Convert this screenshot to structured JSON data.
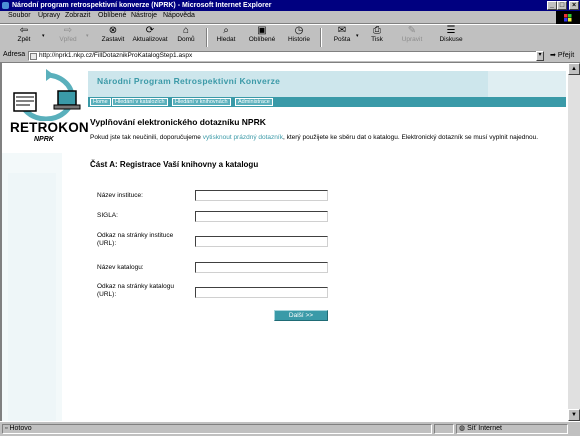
{
  "window": {
    "title": "Národní program retrospektivní konverze (NPRK) - Microsoft Internet Explorer"
  },
  "menu": [
    "Soubor",
    "Úpravy",
    "Zobrazit",
    "Oblíbené",
    "Nástroje",
    "Nápověda"
  ],
  "toolbar": {
    "back": "Zpět",
    "forward": "Vpřed",
    "stop": "Zastavit",
    "refresh": "Aktualizovat",
    "home": "Domů",
    "search": "Hledat",
    "favorites": "Oblíbené",
    "history": "Historie",
    "mail": "Pošta",
    "print": "Tisk",
    "edit": "Upravit",
    "discuss": "Diskuse"
  },
  "address": {
    "label": "Adresa",
    "url": "http://nprk1.nkp.cz/FillDotaznikProKatalogStep1.aspx",
    "go": "Přejít"
  },
  "page": {
    "site_title": "Národní Program Retrospektivní Konverze",
    "nav": [
      "Home",
      "Hledání v katalozích",
      "Hledání v knihovnách",
      "Administrace"
    ],
    "logo_text": "RETROKON",
    "logo_sub": "NPRK",
    "heading": "Vyplňování elektronického dotazníku NPRK",
    "intro_before": "Pokud jste tak neučinili, doporučujeme ",
    "intro_link": "vytisknout prázdný dotazník",
    "intro_after": ", který použijete ke sběru dat o katalogu. Elektronický dotazník se musí vyplnit najednou.",
    "section_title": "Část A: Registrace Vaší knihovny a katalogu",
    "fields": [
      {
        "label": "Název instituce:",
        "value": ""
      },
      {
        "label": "SIGLA:",
        "value": ""
      },
      {
        "label": "Odkaz na stránky instituce (URL):",
        "value": ""
      },
      {
        "label": "Název katalogu:",
        "value": ""
      },
      {
        "label": "Odkaz na stránky katalogu (URL):",
        "value": ""
      }
    ],
    "next_button": "Další >>"
  },
  "status": {
    "text": "Hotovo",
    "zone": "Síť Internet"
  },
  "colors": {
    "accent": "#3a9aa8",
    "header_band": "#dfeef2",
    "titlebar": "#000080"
  }
}
